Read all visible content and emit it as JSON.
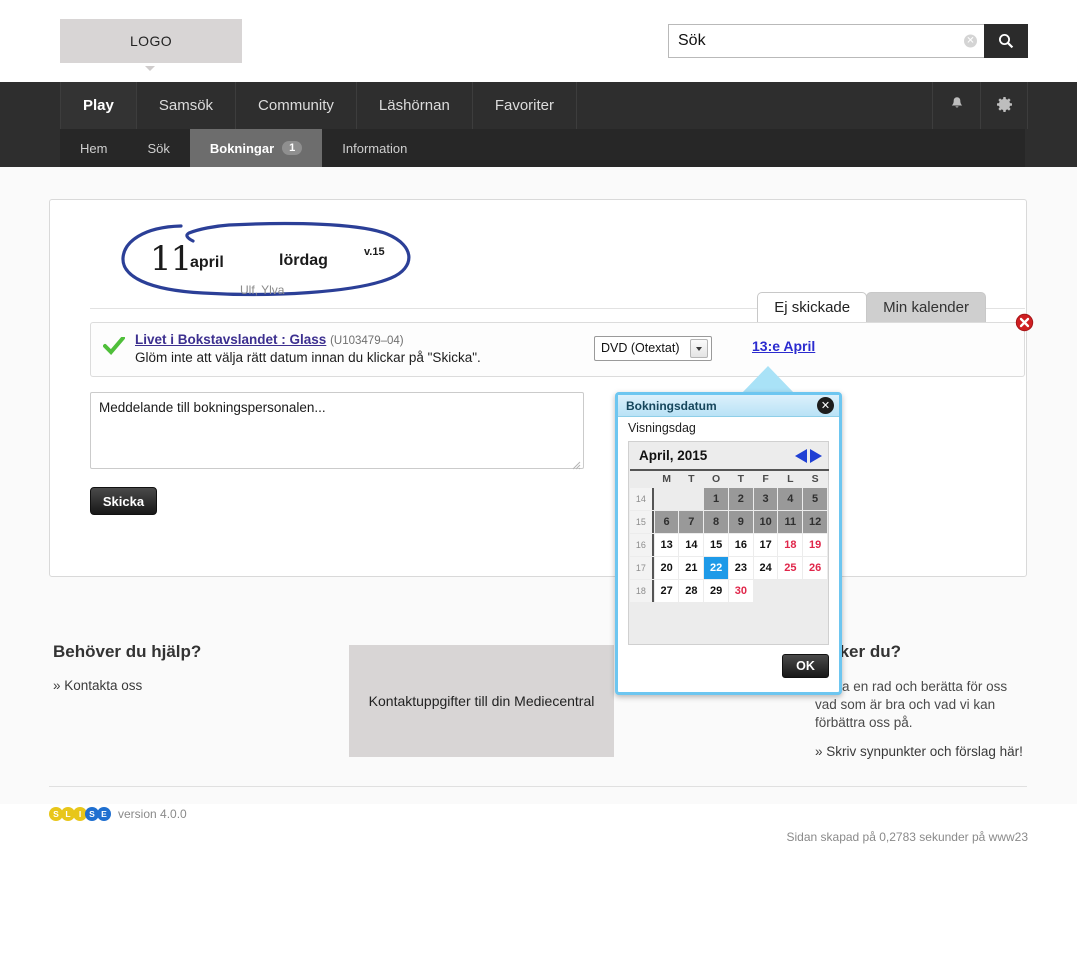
{
  "header": {
    "logo_label": "LOGO",
    "search": {
      "value": "Sök",
      "placeholder": "Sök",
      "clear_icon": "clear-circle-icon",
      "submit_icon": "search-icon"
    }
  },
  "nav": {
    "main_items": [
      {
        "label": "Play",
        "active": true
      },
      {
        "label": "Samsök",
        "active": false
      },
      {
        "label": "Community",
        "active": false
      },
      {
        "label": "Läshörnan",
        "active": false
      },
      {
        "label": "Favoriter",
        "active": false
      }
    ],
    "icons": [
      {
        "name": "bell-icon"
      },
      {
        "name": "gear-icon"
      }
    ],
    "sub_items": [
      {
        "label": "Hem",
        "active": false,
        "badge": ""
      },
      {
        "label": "Sök",
        "active": false,
        "badge": ""
      },
      {
        "label": "Bokningar",
        "active": true,
        "badge": "1"
      },
      {
        "label": "Information",
        "active": false,
        "badge": ""
      }
    ]
  },
  "date_header": {
    "day": "11",
    "month": "april",
    "weekday": "lördag",
    "week": "v.15",
    "namedays": "Ulf, Ylva"
  },
  "tabs": [
    {
      "label": "Ej skickade",
      "active": true
    },
    {
      "label": "Min kalender",
      "active": false
    }
  ],
  "booking": {
    "status_icon": "green-check-icon",
    "title": "Livet i Bokstavslandet : Glass",
    "code": "(U103479–04)",
    "note": "Glöm inte att välja rätt datum innan du klickar på \"Skicka\".",
    "format_selected": "DVD (Otextat)",
    "format_options": [
      "DVD (Otextat)"
    ],
    "date_link": "13:e April",
    "delete_icon": "red-delete-icon"
  },
  "message": {
    "value": "Meddelande till bokningspersonalen...",
    "placeholder": "Meddelande till bokningspersonalen..."
  },
  "submit_label": "Skicka",
  "calendar": {
    "title": "Bokningsdatum",
    "close_icon": "close-icon",
    "subtitle": "Visningsdag",
    "month_label": "April, 2015",
    "prev_icon": "left-arrow-icon",
    "next_icon": "right-arrow-icon",
    "weekday_headers": [
      "",
      "M",
      "T",
      "O",
      "T",
      "F",
      "L",
      "S"
    ],
    "ok_label": "OK",
    "weeks": [
      {
        "week": "14",
        "days": [
          {
            "d": "",
            "state": "blank"
          },
          {
            "d": "",
            "state": "blank"
          },
          {
            "d": "1",
            "state": "off"
          },
          {
            "d": "2",
            "state": "off"
          },
          {
            "d": "3",
            "state": "off"
          },
          {
            "d": "4",
            "state": "off"
          },
          {
            "d": "5",
            "state": "off"
          }
        ]
      },
      {
        "week": "15",
        "days": [
          {
            "d": "6",
            "state": "off"
          },
          {
            "d": "7",
            "state": "off"
          },
          {
            "d": "8",
            "state": "off"
          },
          {
            "d": "9",
            "state": "off"
          },
          {
            "d": "10",
            "state": "off"
          },
          {
            "d": "11",
            "state": "off"
          },
          {
            "d": "12",
            "state": "off"
          }
        ]
      },
      {
        "week": "16",
        "days": [
          {
            "d": "13",
            "state": "on"
          },
          {
            "d": "14",
            "state": "on"
          },
          {
            "d": "15",
            "state": "on"
          },
          {
            "d": "16",
            "state": "on"
          },
          {
            "d": "17",
            "state": "on"
          },
          {
            "d": "18",
            "state": "weekend"
          },
          {
            "d": "19",
            "state": "weekend"
          }
        ]
      },
      {
        "week": "17",
        "days": [
          {
            "d": "20",
            "state": "on"
          },
          {
            "d": "21",
            "state": "on"
          },
          {
            "d": "22",
            "state": "selected"
          },
          {
            "d": "23",
            "state": "on"
          },
          {
            "d": "24",
            "state": "on"
          },
          {
            "d": "25",
            "state": "weekend"
          },
          {
            "d": "26",
            "state": "weekend"
          }
        ]
      },
      {
        "week": "18",
        "days": [
          {
            "d": "27",
            "state": "on"
          },
          {
            "d": "28",
            "state": "on"
          },
          {
            "d": "29",
            "state": "on"
          },
          {
            "d": "30",
            "state": "weekend"
          },
          {
            "d": "",
            "state": "blank"
          },
          {
            "d": "",
            "state": "blank"
          },
          {
            "d": "",
            "state": "blank"
          }
        ]
      }
    ]
  },
  "footer_cols": {
    "help": {
      "title": "Behöver du hjälp?",
      "link": "» Kontakta oss"
    },
    "middle_box": "Kontaktuppgifter till din Mediecentral",
    "feedback": {
      "title": "tycker du?",
      "body": "gärna en rad och berätta för oss vad som är bra och vad vi kan förbättra oss på.",
      "link": "» Skriv synpunkter och förslag här!"
    }
  },
  "footer": {
    "brand_letters": [
      "S",
      "L",
      "I",
      "S",
      "E"
    ],
    "brand_colors": [
      "#e8c61a",
      "#e8c61a",
      "#e8c61a",
      "#1f6fd0",
      "#1f6fd0"
    ],
    "version": "version 4.0.0",
    "gen_time": "Sidan skapad på 0,2783 sekunder på www23"
  }
}
